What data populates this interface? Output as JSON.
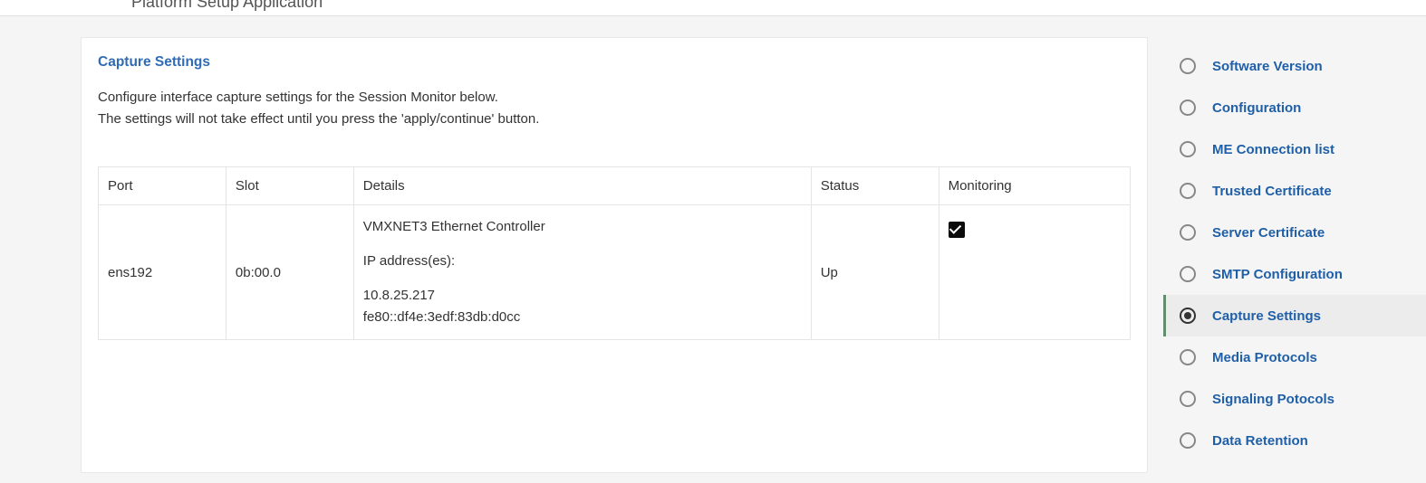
{
  "app": {
    "title_fragment": "Platform Setup Application"
  },
  "card": {
    "title": "Capture Settings",
    "desc_line1": "Configure interface capture settings for the Session Monitor below.",
    "desc_line2": "The settings will not take effect until you press the 'apply/continue' button."
  },
  "table": {
    "headers": {
      "port": "Port",
      "slot": "Slot",
      "details": "Details",
      "status": "Status",
      "monitoring": "Monitoring"
    },
    "row": {
      "port": "ens192",
      "slot": "0b:00.0",
      "controller": "VMXNET3 Ethernet Controller",
      "ip_label": "IP address(es):",
      "ip1": "10.8.25.217",
      "ip2": "fe80::df4e:3edf:83db:d0cc",
      "status": "Up",
      "monitoring_checked": true
    }
  },
  "sidebar": {
    "items": [
      {
        "label": "Software Version",
        "selected": false
      },
      {
        "label": "Configuration",
        "selected": false
      },
      {
        "label": "ME Connection list",
        "selected": false
      },
      {
        "label": "Trusted Certificate",
        "selected": false
      },
      {
        "label": "Server Certificate",
        "selected": false
      },
      {
        "label": "SMTP Configuration",
        "selected": false
      },
      {
        "label": "Capture Settings",
        "selected": true
      },
      {
        "label": "Media Protocols",
        "selected": false
      },
      {
        "label": "Signaling Potocols",
        "selected": false
      },
      {
        "label": "Data Retention",
        "selected": false
      }
    ]
  }
}
